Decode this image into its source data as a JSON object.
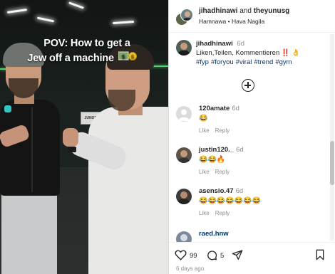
{
  "media": {
    "caption_line1": "POV: How to get a",
    "caption_line2": "Jew off a machine",
    "sign_text": "JUNGEGA"
  },
  "header": {
    "user1": "jihadhinawi",
    "and_text": "and",
    "user2": "theyunusg",
    "audio": "Hamnawa • Hava Nagila"
  },
  "caption": {
    "user": "jihadhinawi",
    "time": "6d",
    "text": "Liken,Teilen, Kommentieren ‼️ 👌",
    "hashtags": [
      "#fyp",
      "#foryou",
      "#viral",
      "#trend",
      "#gym"
    ]
  },
  "comments": [
    {
      "user": "120amate",
      "time": "6d",
      "text": "😂",
      "like": "Like",
      "reply": "Reply"
    },
    {
      "user": "justin120._",
      "time": "6d",
      "text": "😂😂🔥",
      "like": "Like",
      "reply": "Reply"
    },
    {
      "user": "asensio.47",
      "time": "6d",
      "text": "😂😂😂😂😂😂😂",
      "like": "Like",
      "reply": "Reply"
    },
    {
      "user": "raed.hnw",
      "time": "",
      "text": "",
      "like": "",
      "reply": ""
    }
  ],
  "footer": {
    "likes": "99",
    "comments": "5",
    "date": "6 days ago"
  },
  "icons": {
    "like": "heart-icon",
    "comment": "comment-icon",
    "share": "share-icon",
    "save": "bookmark-icon",
    "add": "add-comment-icon"
  },
  "colors": {
    "hashtag": "#00376b",
    "muted": "#8e8e8e",
    "text": "#262626"
  }
}
